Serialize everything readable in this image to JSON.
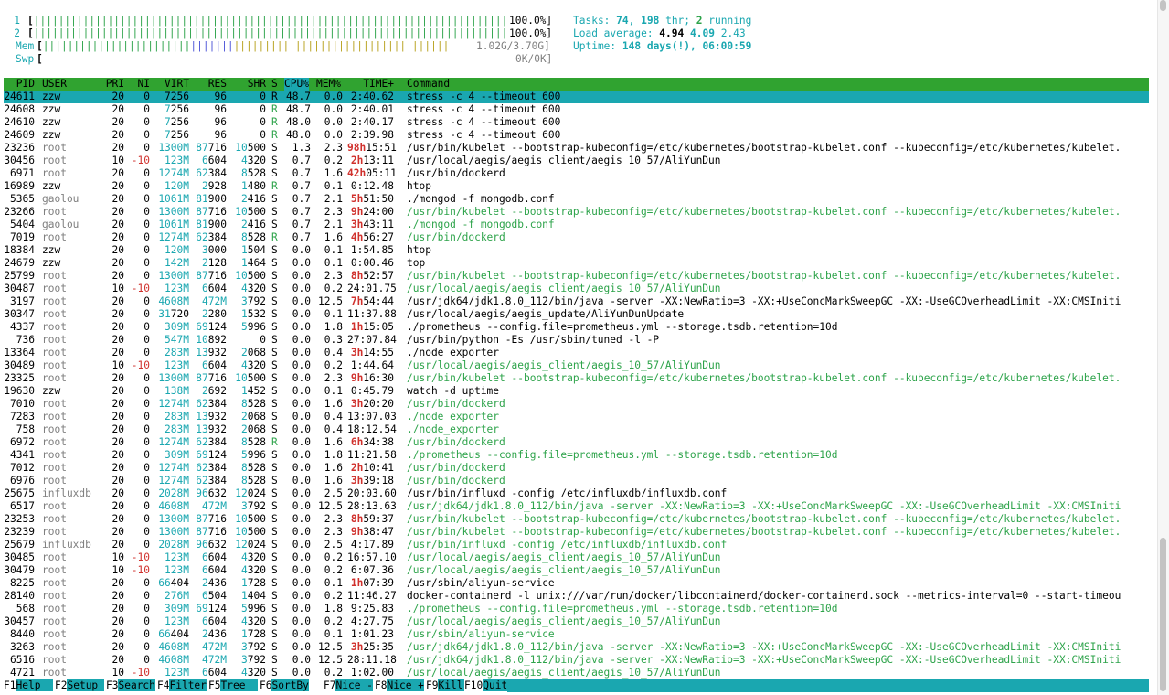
{
  "meters": {
    "cpu1": {
      "label": "1",
      "open": "[",
      "bar": "|||||||||||||||||||||||||||||||||||||||||||||||||||||||||||||||||||||||||||||||||",
      "value": "100.0%]"
    },
    "cpu2": {
      "label": "2",
      "open": "[",
      "bar": "|||||||||||||||||||||||||||||||||||||||||||||||||||||||||||||||||||||||||||||||||",
      "value": "100.0%]"
    },
    "mem": {
      "label": "Mem",
      "open": "[",
      "bar_used": "||||||||||||||||||||||||",
      "bar_buffers": "|||||||",
      "bar_cache": "|||||||||||||||||||||||||||||||||||",
      "value": "1.02G/3.70G]"
    },
    "swp": {
      "label": "Swp",
      "open": "[",
      "value": "0K/0K]"
    }
  },
  "summary": {
    "tasks_label": "Tasks: ",
    "tasks": "74",
    "tasks_sep": ", ",
    "threads": "198",
    "threads_label": " thr; ",
    "running": "2",
    "running_label": " running",
    "load_label": "Load average: ",
    "load1": "4.94",
    "load5": "4.09",
    "load15": "2.43",
    "uptime_label": "Uptime: ",
    "uptime": "148 days(!), 06:00:59"
  },
  "columns": {
    "pid": "PID",
    "user": "USER",
    "pri": "PRI",
    "ni": "NI",
    "virt": "VIRT",
    "res": "RES",
    "shr": "SHR",
    "s": "S",
    "cpu": "CPU%",
    "mem": "MEM%",
    "time": "TIME+",
    "cmd": "Command"
  },
  "processes": [
    {
      "pid": "24611",
      "user": "zzw",
      "pri": "20",
      "ni": "0",
      "virt": "7256",
      "res": "96",
      "shr": "0",
      "s": "R",
      "cpu": "48.7",
      "mem": "0.0",
      "time": "2:40.62",
      "cmd": "stress -c 4 --timeout 600",
      "selected": true
    },
    {
      "pid": "24608",
      "user": "zzw",
      "pri": "20",
      "ni": "0",
      "virt": "7256",
      "res": "96",
      "shr": "0",
      "s": "R",
      "cpu": "48.7",
      "mem": "0.0",
      "time": "2:40.01",
      "cmd": "stress -c 4 --timeout 600"
    },
    {
      "pid": "24610",
      "user": "zzw",
      "pri": "20",
      "ni": "0",
      "virt": "7256",
      "res": "96",
      "shr": "0",
      "s": "R",
      "cpu": "48.0",
      "mem": "0.0",
      "time": "2:40.17",
      "cmd": "stress -c 4 --timeout 600"
    },
    {
      "pid": "24609",
      "user": "zzw",
      "pri": "20",
      "ni": "0",
      "virt": "7256",
      "res": "96",
      "shr": "0",
      "s": "R",
      "cpu": "48.0",
      "mem": "0.0",
      "time": "2:39.98",
      "cmd": "stress -c 4 --timeout 600"
    },
    {
      "pid": "23236",
      "user": "root",
      "pri": "20",
      "ni": "0",
      "virt": "1300M",
      "res": "87716",
      "shr": "10500",
      "s": "S",
      "cpu": "1.3",
      "mem": "2.3",
      "time": "98h15:51",
      "cmd": "/usr/bin/kubelet --bootstrap-kubeconfig=/etc/kubernetes/bootstrap-kubelet.conf --kubeconfig=/etc/kubernetes/kubelet."
    },
    {
      "pid": "30456",
      "user": "root",
      "pri": "10",
      "ni": "-10",
      "virt": "123M",
      "res": "6604",
      "shr": "4320",
      "s": "S",
      "cpu": "0.7",
      "mem": "0.2",
      "time": "2h13:11",
      "cmd": "/usr/local/aegis/aegis_client/aegis_10_57/AliYunDun"
    },
    {
      "pid": "6971",
      "user": "root",
      "pri": "20",
      "ni": "0",
      "virt": "1274M",
      "res": "62384",
      "shr": "8528",
      "s": "S",
      "cpu": "0.7",
      "mem": "1.6",
      "time": "42h05:11",
      "cmd": "/usr/bin/dockerd"
    },
    {
      "pid": "16989",
      "user": "zzw",
      "pri": "20",
      "ni": "0",
      "virt": "120M",
      "res": "2928",
      "shr": "1480",
      "s": "R",
      "cpu": "0.7",
      "mem": "0.1",
      "time": "0:12.48",
      "cmd": "htop"
    },
    {
      "pid": "5365",
      "user": "gaolou",
      "pri": "20",
      "ni": "0",
      "virt": "1061M",
      "res": "81900",
      "shr": "2416",
      "s": "S",
      "cpu": "0.7",
      "mem": "2.1",
      "time": "5h51:50",
      "cmd": "./mongod -f mongodb.conf"
    },
    {
      "pid": "23266",
      "user": "root",
      "pri": "20",
      "ni": "0",
      "virt": "1300M",
      "res": "87716",
      "shr": "10500",
      "s": "S",
      "cpu": "0.7",
      "mem": "2.3",
      "time": "9h24:00",
      "cmd": "/usr/bin/kubelet --bootstrap-kubeconfig=/etc/kubernetes/bootstrap-kubelet.conf --kubeconfig=/etc/kubernetes/kubelet.",
      "thread": true
    },
    {
      "pid": "5404",
      "user": "gaolou",
      "pri": "20",
      "ni": "0",
      "virt": "1061M",
      "res": "81900",
      "shr": "2416",
      "s": "S",
      "cpu": "0.7",
      "mem": "2.1",
      "time": "3h43:11",
      "cmd": "./mongod -f mongodb.conf",
      "thread": true
    },
    {
      "pid": "7019",
      "user": "root",
      "pri": "20",
      "ni": "0",
      "virt": "1274M",
      "res": "62384",
      "shr": "8528",
      "s": "R",
      "cpu": "0.7",
      "mem": "1.6",
      "time": "4h56:27",
      "cmd": "/usr/bin/dockerd",
      "thread": true
    },
    {
      "pid": "18384",
      "user": "zzw",
      "pri": "20",
      "ni": "0",
      "virt": "120M",
      "res": "3000",
      "shr": "1504",
      "s": "S",
      "cpu": "0.0",
      "mem": "0.1",
      "time": "1:54.85",
      "cmd": "htop"
    },
    {
      "pid": "24679",
      "user": "zzw",
      "pri": "20",
      "ni": "0",
      "virt": "142M",
      "res": "2128",
      "shr": "1464",
      "s": "S",
      "cpu": "0.0",
      "mem": "0.1",
      "time": "0:00.46",
      "cmd": "top"
    },
    {
      "pid": "25799",
      "user": "root",
      "pri": "20",
      "ni": "0",
      "virt": "1300M",
      "res": "87716",
      "shr": "10500",
      "s": "S",
      "cpu": "0.0",
      "mem": "2.3",
      "time": "8h52:57",
      "cmd": "/usr/bin/kubelet --bootstrap-kubeconfig=/etc/kubernetes/bootstrap-kubelet.conf --kubeconfig=/etc/kubernetes/kubelet.",
      "thread": true
    },
    {
      "pid": "30487",
      "user": "root",
      "pri": "10",
      "ni": "-10",
      "virt": "123M",
      "res": "6604",
      "shr": "4320",
      "s": "S",
      "cpu": "0.0",
      "mem": "0.2",
      "time": "24:01.75",
      "cmd": "/usr/local/aegis/aegis_client/aegis_10_57/AliYunDun",
      "thread": true
    },
    {
      "pid": "3197",
      "user": "root",
      "pri": "20",
      "ni": "0",
      "virt": "4608M",
      "res": "472M",
      "shr": "3792",
      "s": "S",
      "cpu": "0.0",
      "mem": "12.5",
      "time": "7h54:44",
      "cmd": "/usr/jdk64/jdk1.8.0_112/bin/java -server -XX:NewRatio=3 -XX:+UseConcMarkSweepGC -XX:-UseGCOverheadLimit -XX:CMSIniti"
    },
    {
      "pid": "30347",
      "user": "root",
      "pri": "20",
      "ni": "0",
      "virt": "31720",
      "res": "2280",
      "shr": "1532",
      "s": "S",
      "cpu": "0.0",
      "mem": "0.1",
      "time": "11:37.88",
      "cmd": "/usr/local/aegis/aegis_update/AliYunDunUpdate"
    },
    {
      "pid": "4337",
      "user": "root",
      "pri": "20",
      "ni": "0",
      "virt": "309M",
      "res": "69124",
      "shr": "5996",
      "s": "S",
      "cpu": "0.0",
      "mem": "1.8",
      "time": "1h15:05",
      "cmd": "./prometheus --config.file=prometheus.yml --storage.tsdb.retention=10d"
    },
    {
      "pid": "736",
      "user": "root",
      "pri": "20",
      "ni": "0",
      "virt": "547M",
      "res": "10892",
      "shr": "0",
      "s": "S",
      "cpu": "0.0",
      "mem": "0.3",
      "time": "27:07.84",
      "cmd": "/usr/bin/python -Es /usr/sbin/tuned -l -P"
    },
    {
      "pid": "13364",
      "user": "root",
      "pri": "20",
      "ni": "0",
      "virt": "283M",
      "res": "13932",
      "shr": "2068",
      "s": "S",
      "cpu": "0.0",
      "mem": "0.4",
      "time": "3h14:55",
      "cmd": "./node_exporter"
    },
    {
      "pid": "30489",
      "user": "root",
      "pri": "10",
      "ni": "-10",
      "virt": "123M",
      "res": "6604",
      "shr": "4320",
      "s": "S",
      "cpu": "0.0",
      "mem": "0.2",
      "time": "1:44.64",
      "cmd": "/usr/local/aegis/aegis_client/aegis_10_57/AliYunDun",
      "thread": true
    },
    {
      "pid": "23325",
      "user": "root",
      "pri": "20",
      "ni": "0",
      "virt": "1300M",
      "res": "87716",
      "shr": "10500",
      "s": "S",
      "cpu": "0.0",
      "mem": "2.3",
      "time": "9h16:30",
      "cmd": "/usr/bin/kubelet --bootstrap-kubeconfig=/etc/kubernetes/bootstrap-kubelet.conf --kubeconfig=/etc/kubernetes/kubelet.",
      "thread": true
    },
    {
      "pid": "19630",
      "user": "zzw",
      "pri": "20",
      "ni": "0",
      "virt": "138M",
      "res": "2692",
      "shr": "1452",
      "s": "S",
      "cpu": "0.0",
      "mem": "0.1",
      "time": "0:45.79",
      "cmd": "watch -d uptime"
    },
    {
      "pid": "7010",
      "user": "root",
      "pri": "20",
      "ni": "0",
      "virt": "1274M",
      "res": "62384",
      "shr": "8528",
      "s": "S",
      "cpu": "0.0",
      "mem": "1.6",
      "time": "3h20:20",
      "cmd": "/usr/bin/dockerd",
      "thread": true
    },
    {
      "pid": "7283",
      "user": "root",
      "pri": "20",
      "ni": "0",
      "virt": "283M",
      "res": "13932",
      "shr": "2068",
      "s": "S",
      "cpu": "0.0",
      "mem": "0.4",
      "time": "13:07.03",
      "cmd": "./node_exporter",
      "thread": true
    },
    {
      "pid": "758",
      "user": "root",
      "pri": "20",
      "ni": "0",
      "virt": "283M",
      "res": "13932",
      "shr": "2068",
      "s": "S",
      "cpu": "0.0",
      "mem": "0.4",
      "time": "18:12.54",
      "cmd": "./node_exporter",
      "thread": true
    },
    {
      "pid": "6972",
      "user": "root",
      "pri": "20",
      "ni": "0",
      "virt": "1274M",
      "res": "62384",
      "shr": "8528",
      "s": "R",
      "cpu": "0.0",
      "mem": "1.6",
      "time": "6h34:38",
      "cmd": "/usr/bin/dockerd",
      "thread": true
    },
    {
      "pid": "4341",
      "user": "root",
      "pri": "20",
      "ni": "0",
      "virt": "309M",
      "res": "69124",
      "shr": "5996",
      "s": "S",
      "cpu": "0.0",
      "mem": "1.8",
      "time": "11:21.58",
      "cmd": "./prometheus --config.file=prometheus.yml --storage.tsdb.retention=10d",
      "thread": true
    },
    {
      "pid": "7012",
      "user": "root",
      "pri": "20",
      "ni": "0",
      "virt": "1274M",
      "res": "62384",
      "shr": "8528",
      "s": "S",
      "cpu": "0.0",
      "mem": "1.6",
      "time": "2h10:41",
      "cmd": "/usr/bin/dockerd",
      "thread": true
    },
    {
      "pid": "6976",
      "user": "root",
      "pri": "20",
      "ni": "0",
      "virt": "1274M",
      "res": "62384",
      "shr": "8528",
      "s": "S",
      "cpu": "0.0",
      "mem": "1.6",
      "time": "3h39:18",
      "cmd": "/usr/bin/dockerd",
      "thread": true
    },
    {
      "pid": "25675",
      "user": "influxdb",
      "pri": "20",
      "ni": "0",
      "virt": "2028M",
      "res": "96632",
      "shr": "12024",
      "s": "S",
      "cpu": "0.0",
      "mem": "2.5",
      "time": "20:03.60",
      "cmd": "/usr/bin/influxd -config /etc/influxdb/influxdb.conf"
    },
    {
      "pid": "6517",
      "user": "root",
      "pri": "20",
      "ni": "0",
      "virt": "4608M",
      "res": "472M",
      "shr": "3792",
      "s": "S",
      "cpu": "0.0",
      "mem": "12.5",
      "time": "28:13.63",
      "cmd": "/usr/jdk64/jdk1.8.0_112/bin/java -server -XX:NewRatio=3 -XX:+UseConcMarkSweepGC -XX:-UseGCOverheadLimit -XX:CMSIniti",
      "thread": true
    },
    {
      "pid": "23253",
      "user": "root",
      "pri": "20",
      "ni": "0",
      "virt": "1300M",
      "res": "87716",
      "shr": "10500",
      "s": "S",
      "cpu": "0.0",
      "mem": "2.3",
      "time": "8h59:37",
      "cmd": "/usr/bin/kubelet --bootstrap-kubeconfig=/etc/kubernetes/bootstrap-kubelet.conf --kubeconfig=/etc/kubernetes/kubelet.",
      "thread": true
    },
    {
      "pid": "23239",
      "user": "root",
      "pri": "20",
      "ni": "0",
      "virt": "1300M",
      "res": "87716",
      "shr": "10500",
      "s": "S",
      "cpu": "0.0",
      "mem": "2.3",
      "time": "9h38:47",
      "cmd": "/usr/bin/kubelet --bootstrap-kubeconfig=/etc/kubernetes/bootstrap-kubelet.conf --kubeconfig=/etc/kubernetes/kubelet.",
      "thread": true
    },
    {
      "pid": "25679",
      "user": "influxdb",
      "pri": "20",
      "ni": "0",
      "virt": "2028M",
      "res": "96632",
      "shr": "12024",
      "s": "S",
      "cpu": "0.0",
      "mem": "2.5",
      "time": "4:17.89",
      "cmd": "/usr/bin/influxd -config /etc/influxdb/influxdb.conf",
      "thread": true
    },
    {
      "pid": "30485",
      "user": "root",
      "pri": "10",
      "ni": "-10",
      "virt": "123M",
      "res": "6604",
      "shr": "4320",
      "s": "S",
      "cpu": "0.0",
      "mem": "0.2",
      "time": "16:57.10",
      "cmd": "/usr/local/aegis/aegis_client/aegis_10_57/AliYunDun",
      "thread": true
    },
    {
      "pid": "30479",
      "user": "root",
      "pri": "10",
      "ni": "-10",
      "virt": "123M",
      "res": "6604",
      "shr": "4320",
      "s": "S",
      "cpu": "0.0",
      "mem": "0.2",
      "time": "6:07.36",
      "cmd": "/usr/local/aegis/aegis_client/aegis_10_57/AliYunDun",
      "thread": true
    },
    {
      "pid": "8225",
      "user": "root",
      "pri": "20",
      "ni": "0",
      "virt": "66404",
      "res": "2436",
      "shr": "1728",
      "s": "S",
      "cpu": "0.0",
      "mem": "0.1",
      "time": "1h07:39",
      "cmd": "/usr/sbin/aliyun-service"
    },
    {
      "pid": "28140",
      "user": "root",
      "pri": "20",
      "ni": "0",
      "virt": "276M",
      "res": "6504",
      "shr": "1404",
      "s": "S",
      "cpu": "0.0",
      "mem": "0.2",
      "time": "11:46.27",
      "cmd": "docker-containerd -l unix:///var/run/docker/libcontainerd/docker-containerd.sock --metrics-interval=0 --start-timeou"
    },
    {
      "pid": "568",
      "user": "root",
      "pri": "20",
      "ni": "0",
      "virt": "309M",
      "res": "69124",
      "shr": "5996",
      "s": "S",
      "cpu": "0.0",
      "mem": "1.8",
      "time": "9:25.83",
      "cmd": "./prometheus --config.file=prometheus.yml --storage.tsdb.retention=10d",
      "thread": true
    },
    {
      "pid": "30457",
      "user": "root",
      "pri": "20",
      "ni": "0",
      "virt": "123M",
      "res": "6604",
      "shr": "4320",
      "s": "S",
      "cpu": "0.0",
      "mem": "0.2",
      "time": "4:27.75",
      "cmd": "/usr/local/aegis/aegis_client/aegis_10_57/AliYunDun",
      "thread": true
    },
    {
      "pid": "8440",
      "user": "root",
      "pri": "20",
      "ni": "0",
      "virt": "66404",
      "res": "2436",
      "shr": "1728",
      "s": "S",
      "cpu": "0.0",
      "mem": "0.1",
      "time": "1:01.23",
      "cmd": "/usr/sbin/aliyun-service",
      "thread": true
    },
    {
      "pid": "3263",
      "user": "root",
      "pri": "20",
      "ni": "0",
      "virt": "4608M",
      "res": "472M",
      "shr": "3792",
      "s": "S",
      "cpu": "0.0",
      "mem": "12.5",
      "time": "3h25:35",
      "cmd": "/usr/jdk64/jdk1.8.0_112/bin/java -server -XX:NewRatio=3 -XX:+UseConcMarkSweepGC -XX:-UseGCOverheadLimit -XX:CMSIniti",
      "thread": true
    },
    {
      "pid": "6516",
      "user": "root",
      "pri": "20",
      "ni": "0",
      "virt": "4608M",
      "res": "472M",
      "shr": "3792",
      "s": "S",
      "cpu": "0.0",
      "mem": "12.5",
      "time": "28:11.18",
      "cmd": "/usr/jdk64/jdk1.8.0_112/bin/java -server -XX:NewRatio=3 -XX:+UseConcMarkSweepGC -XX:-UseGCOverheadLimit -XX:CMSIniti",
      "thread": true
    },
    {
      "pid": "4721",
      "user": "root",
      "pri": "10",
      "ni": "-10",
      "virt": "123M",
      "res": "6604",
      "shr": "4320",
      "s": "S",
      "cpu": "0.0",
      "mem": "0.2",
      "time": "1:02.00",
      "cmd": "/usr/local/aegis/aegis_client/aegis_10_57/AliYunDun",
      "thread": true
    }
  ],
  "footer": [
    {
      "key": "F1",
      "label": "Help  "
    },
    {
      "key": "F2",
      "label": "Setup "
    },
    {
      "key": "F3",
      "label": "Search"
    },
    {
      "key": "F4",
      "label": "Filter"
    },
    {
      "key": "F5",
      "label": "Tree  "
    },
    {
      "key": "F6",
      "label": "SortBy"
    },
    {
      "key": "F7",
      "label": "Nice -"
    },
    {
      "key": "F8",
      "label": "Nice +"
    },
    {
      "key": "F9",
      "label": "Kill  "
    },
    {
      "key": "F10",
      "label": "Quit"
    }
  ],
  "colors": {
    "green": "#2da34a",
    "cyan": "#1aa7b0",
    "red": "#d0312d"
  }
}
